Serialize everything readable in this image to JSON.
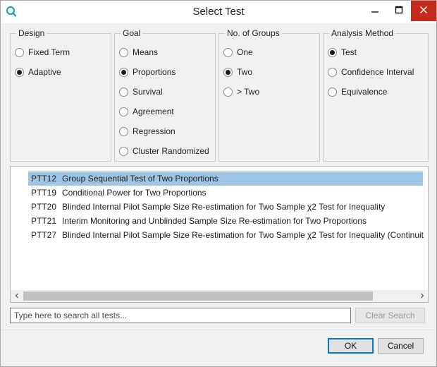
{
  "window": {
    "title": "Select Test",
    "app_icon": "search-q-icon",
    "controls": [
      "minimize-icon",
      "maximize-icon",
      "close-icon"
    ]
  },
  "design": {
    "label": "Design",
    "options": [
      {
        "label": "Fixed Term",
        "checked": false
      },
      {
        "label": "Adaptive",
        "checked": true
      }
    ]
  },
  "goal": {
    "label": "Goal",
    "options": [
      {
        "label": "Means",
        "checked": false
      },
      {
        "label": "Proportions",
        "checked": true
      },
      {
        "label": "Survival",
        "checked": false
      },
      {
        "label": "Agreement",
        "checked": false
      },
      {
        "label": "Regression",
        "checked": false
      },
      {
        "label": "Cluster Randomized",
        "checked": false
      }
    ]
  },
  "groups": {
    "label": "No. of Groups",
    "options": [
      {
        "label": "One",
        "checked": false
      },
      {
        "label": "Two",
        "checked": true
      },
      {
        "label": "> Two",
        "checked": false
      }
    ]
  },
  "analysis": {
    "label": "Analysis Method",
    "options": [
      {
        "label": "Test",
        "checked": true
      },
      {
        "label": "Confidence Interval",
        "checked": false
      },
      {
        "label": "Equivalence",
        "checked": false
      }
    ]
  },
  "tests": [
    {
      "code": "PTT12",
      "name": "Group Sequential Test of Two Proportions",
      "selected": true
    },
    {
      "code": "PTT19",
      "name": "Conditional Power for Two Proportions",
      "selected": false
    },
    {
      "code": "PTT20",
      "name": "Blinded Internal Pilot Sample Size Re-estimation for Two Sample χ2 Test for Inequality",
      "selected": false
    },
    {
      "code": "PTT21",
      "name": "Interim Monitoring and Unblinded Sample Size Re-estimation for Two Proportions",
      "selected": false
    },
    {
      "code": "PTT27",
      "name": "Blinded Internal Pilot Sample Size Re-estimation for Two Sample χ2 Test for Inequality (Continuit",
      "selected": false
    }
  ],
  "search": {
    "placeholder": "Type here to search all tests...",
    "value": "",
    "clear_label": "Clear Search"
  },
  "footer": {
    "ok_label": "OK",
    "cancel_label": "Cancel"
  },
  "colors": {
    "selection": "#9ec5e4",
    "close_button": "#c42b1c",
    "app_icon": "#1aa3b8"
  }
}
